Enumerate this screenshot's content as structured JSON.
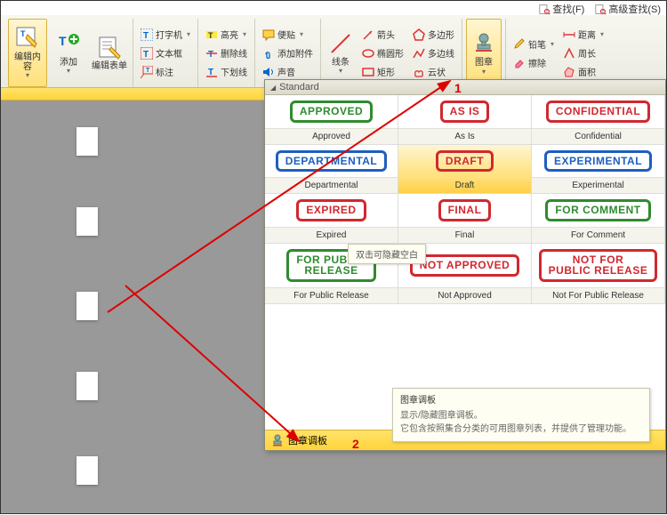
{
  "findbar": {
    "find": "查找(F)",
    "advfind": "高级查找(S)"
  },
  "ribbon": {
    "edit_content": "编辑内容",
    "add": "添加",
    "edit_form": "编辑表单",
    "grp_text": {
      "typewriter": "打字机",
      "textbox": "文本框",
      "annotate": "标注"
    },
    "grp_fmt": {
      "highlight": "高亮",
      "strikeout": "删除线",
      "underline": "下划线"
    },
    "grp_insert": {
      "note": "便贴",
      "attach": "添加附件",
      "sound": "声音"
    },
    "grp_line": {
      "line": "线条",
      "arrow": "箭头",
      "ellipse": "椭圆形",
      "rect": "矩形",
      "polygon": "多边形",
      "polyline": "多边线",
      "cloud": "云状"
    },
    "stamp": "图章",
    "grp_tool": {
      "pencil": "铅笔",
      "eraser": "擦除",
      "distance": "距离",
      "perimeter": "周长",
      "area": "面积"
    }
  },
  "palette": {
    "title": "Standard",
    "footer": "图章调板",
    "items": [
      {
        "txt": "APPROVED",
        "label": "Approved",
        "color": "c-green"
      },
      {
        "txt": "AS IS",
        "label": "As Is",
        "color": "c-red"
      },
      {
        "txt": "CONFIDENTIAL",
        "label": "Confidential",
        "color": "c-red"
      },
      {
        "txt": "DEPARTMENTAL",
        "label": "Departmental",
        "color": "c-blue"
      },
      {
        "txt": "DRAFT",
        "label": "Draft",
        "color": "c-red"
      },
      {
        "txt": "EXPERIMENTAL",
        "label": "Experimental",
        "color": "c-blue"
      },
      {
        "txt": "EXPIRED",
        "label": "Expired",
        "color": "c-red"
      },
      {
        "txt": "FINAL",
        "label": "Final",
        "color": "c-red"
      },
      {
        "txt": "FOR COMMENT",
        "label": "For Comment",
        "color": "c-green"
      },
      {
        "txt": "FOR PUBLIC\nRELEASE",
        "label": "For Public Release",
        "color": "c-green"
      },
      {
        "txt": "NOT APPROVED",
        "label": "Not Approved",
        "color": "c-red"
      },
      {
        "txt": "NOT FOR\nPUBLIC RELEASE",
        "label": "Not For Public Release",
        "color": "c-red"
      }
    ]
  },
  "tooltip1": "双击可隐藏空白",
  "tooltip2": {
    "title": "图章调板",
    "line1": "显示/隐藏图章调板。",
    "line2": "它包含按照集合分类的可用图章列表，并提供了管理功能。"
  },
  "anno": {
    "n1": "1",
    "n2": "2"
  }
}
